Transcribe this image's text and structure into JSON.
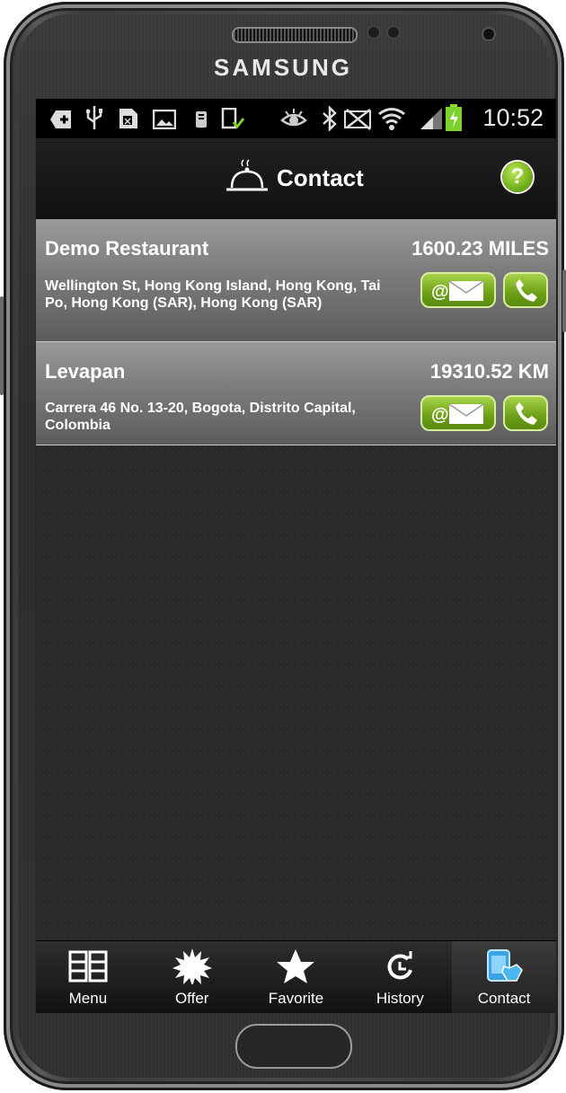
{
  "device": {
    "brand": "SAMSUNG"
  },
  "status_bar": {
    "time": "10:52",
    "icons": [
      "add-notification-icon",
      "usb-icon",
      "sim-icon",
      "image-icon",
      "sd-icon",
      "download-done-icon",
      "eye-icon",
      "bluetooth-icon",
      "mute-icon",
      "wifi-icon",
      "signal-icon",
      "battery-charging-icon"
    ]
  },
  "header": {
    "title": "Contact",
    "help_label": "?"
  },
  "contacts": [
    {
      "name": "Demo Restaurant",
      "distance": "1600.23 MILES",
      "address": "Wellington St, Hong Kong Island, Hong Kong, Tai Po, Hong Kong (SAR), Hong Kong (SAR)",
      "mail_label": "@"
    },
    {
      "name": "Levapan",
      "distance": "19310.52 KM",
      "address": "Carrera 46 No. 13-20, Bogota, Distrito Capital, Colombia",
      "mail_label": "@"
    }
  ],
  "tabs": [
    {
      "label": "Menu",
      "icon": "menu-grid-icon"
    },
    {
      "label": "Offer",
      "icon": "starburst-icon"
    },
    {
      "label": "Favorite",
      "icon": "star-icon"
    },
    {
      "label": "History",
      "icon": "history-icon"
    },
    {
      "label": "Contact",
      "icon": "contact-phone-icon",
      "active": true
    }
  ],
  "colors": {
    "accent_green": "#6d9f16",
    "row_gray": "#7e7e7e",
    "background": "#2a2a2a"
  }
}
